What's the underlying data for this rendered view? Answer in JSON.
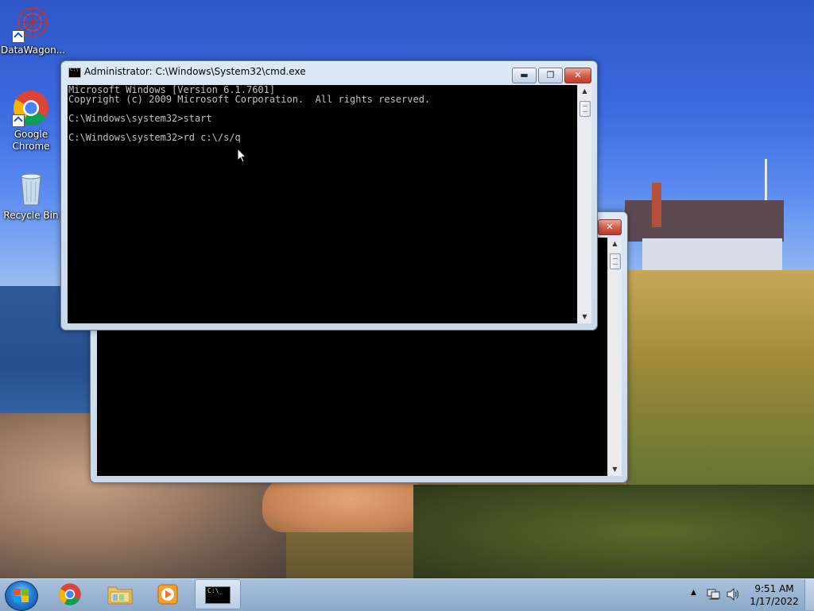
{
  "desktop": {
    "icons": [
      {
        "label": "DataWagon..."
      },
      {
        "label": "Google\nChrome"
      },
      {
        "label": "Recycle Bin"
      }
    ]
  },
  "cmd_window": {
    "title": "Administrator: C:\\Windows\\System32\\cmd.exe",
    "minimize_glyph": "▬",
    "maximize_glyph": "❐",
    "close_glyph": "✕",
    "console_lines": [
      "Microsoft Windows [Version 6.1.7601]",
      "Copyright (c) 2009 Microsoft Corporation.  All rights reserved.",
      "",
      "C:\\Windows\\system32>start",
      "",
      "C:\\Windows\\system32>rd c:\\/s/q"
    ]
  },
  "back_window": {
    "close_glyph": "✕"
  },
  "taskbar": {
    "time": "9:51 AM",
    "date": "1/17/2022",
    "cmd_glyph": "C:\\_",
    "tray_arrow": "▲"
  },
  "colors": {
    "console_bg": "#000000",
    "console_fg": "#c0c0c0",
    "close_red": "#c0392b"
  }
}
